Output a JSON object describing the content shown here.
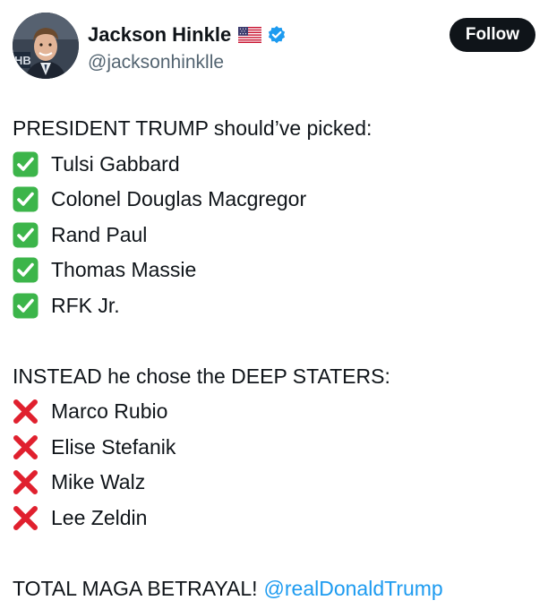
{
  "author": {
    "name": "Jackson Hinkle",
    "handle": "@jacksonhinklle",
    "avatar_badge_text": "HB",
    "flag_icon": "us-flag-icon",
    "verified_icon": "verified-badge-icon"
  },
  "follow_button": {
    "label": "Follow"
  },
  "tweet": {
    "intro": "PRESIDENT TRUMP should’ve picked:",
    "picked": [
      "Tulsi Gabbard",
      "Colonel Douglas Macgregor",
      "Rand Paul",
      "Thomas Massie",
      "RFK Jr."
    ],
    "instead_heading": "INSTEAD he chose the DEEP STATERS:",
    "chosen": [
      "Marco Rubio",
      "Elise Stefanik",
      "Mike Walz",
      "Lee Zeldin"
    ],
    "closing_text": "TOTAL MAGA BETRAYAL!",
    "closing_mention": "@realDonaldTrump"
  },
  "colors": {
    "text": "#0f1419",
    "secondary": "#536471",
    "accent": "#1d9bf0",
    "check_green": "#3cb54a",
    "cross_red": "#e0202e"
  }
}
